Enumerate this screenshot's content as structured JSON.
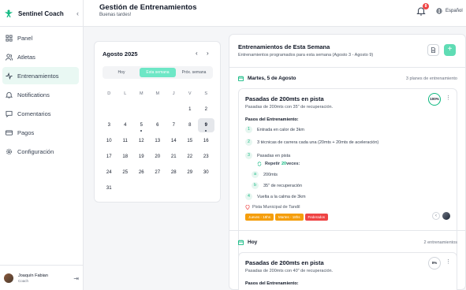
{
  "app": {
    "name": "Sentinel Coach",
    "collapse_icon": "chevron-left-icon"
  },
  "sidebar": {
    "items": [
      {
        "label": "Panel",
        "icon": "grid-icon"
      },
      {
        "label": "Atletas",
        "icon": "users-icon"
      },
      {
        "label": "Entrenamientos",
        "icon": "activity-icon",
        "active": true
      },
      {
        "label": "Notifications",
        "icon": "bell-icon"
      },
      {
        "label": "Comentarios",
        "icon": "message-icon"
      },
      {
        "label": "Pagos",
        "icon": "card-icon"
      },
      {
        "label": "Configuración",
        "icon": "gear-icon"
      }
    ],
    "user": {
      "name": "Joaquín Fabian",
      "role": "Coach"
    }
  },
  "header": {
    "title": "Gestión de Entrenamientos",
    "subtitle": "Buenas tardes!",
    "notifications_count": "8",
    "language": "Español"
  },
  "calendar": {
    "month": "Agosto 2025",
    "prev": "‹",
    "next": "›",
    "tabs": [
      "Hoy",
      "Esta semana",
      "Próx. semana"
    ],
    "active_tab": 1,
    "weekdays": [
      "D",
      "L",
      "M",
      "M",
      "J",
      "V",
      "S"
    ],
    "weeks": [
      [
        "",
        "",
        "",
        "",
        "",
        "1",
        "2"
      ],
      [
        "3",
        "4",
        "5",
        "6",
        "7",
        "8",
        "9"
      ],
      [
        "10",
        "11",
        "12",
        "13",
        "14",
        "15",
        "16"
      ],
      [
        "17",
        "18",
        "19",
        "20",
        "21",
        "22",
        "23"
      ],
      [
        "24",
        "25",
        "26",
        "27",
        "28",
        "29",
        "30"
      ],
      [
        "31",
        "",
        "",
        "",
        "",
        "",
        ""
      ]
    ],
    "selected_day": "9",
    "dot_days": [
      "5",
      "9"
    ]
  },
  "week_panel": {
    "title": "Entrenamientos de Esta Semana",
    "subtitle": "Entrenamientos programados para esta semana (Agosto 3 - Agosto 9)",
    "add_label": "+",
    "days": [
      {
        "label": "Martes, 5 de Agosto",
        "count": "3 planes de entrenamiento",
        "card": {
          "title": "Pasadas de 200mts en pista",
          "desc": "Pasadas de 200mts con 35\" de recuperación.",
          "progress": "100%",
          "steps_title": "Pasos del Entrenamiento:",
          "steps": [
            {
              "n": "1",
              "text": "Entrada en calor de 3km"
            },
            {
              "n": "2",
              "text": "3 técnicas de carrera cada una (20mts + 20mts de aceleración)"
            },
            {
              "n": "3",
              "text": "Pasadas en pista"
            }
          ],
          "repeat_prefix": "Repetir ",
          "repeat_count": "20",
          "repeat_suffix": " veces:",
          "sub_steps": [
            {
              "n": "a",
              "text": "200mts"
            },
            {
              "n": "b",
              "text": "35\" de recuperación"
            }
          ],
          "final_step": {
            "n": "4",
            "text": "Vuelta a la calma de 3km"
          },
          "location": "Pista Municipal de Tandil",
          "tags": [
            {
              "label": "Jueves - 18hs",
              "color": "#f59e0b"
            },
            {
              "label": "Martes - 18hs",
              "color": "#f59e0b"
            },
            {
              "label": "Federados",
              "color": "#ef4444"
            }
          ]
        }
      },
      {
        "label": "Hoy",
        "count": "2 entrenamientos",
        "card": {
          "title": "Pasadas de 200mts en pista",
          "desc": "Pasadas de 200mts con 40\" de recuperación.",
          "progress": "0%",
          "steps_title": "Pasos del Entrenamiento:"
        }
      }
    ]
  },
  "colors": {
    "accent": "#5fdcb4",
    "active_nav_bg": "#e9f8f3",
    "badge": "#ef4444"
  }
}
